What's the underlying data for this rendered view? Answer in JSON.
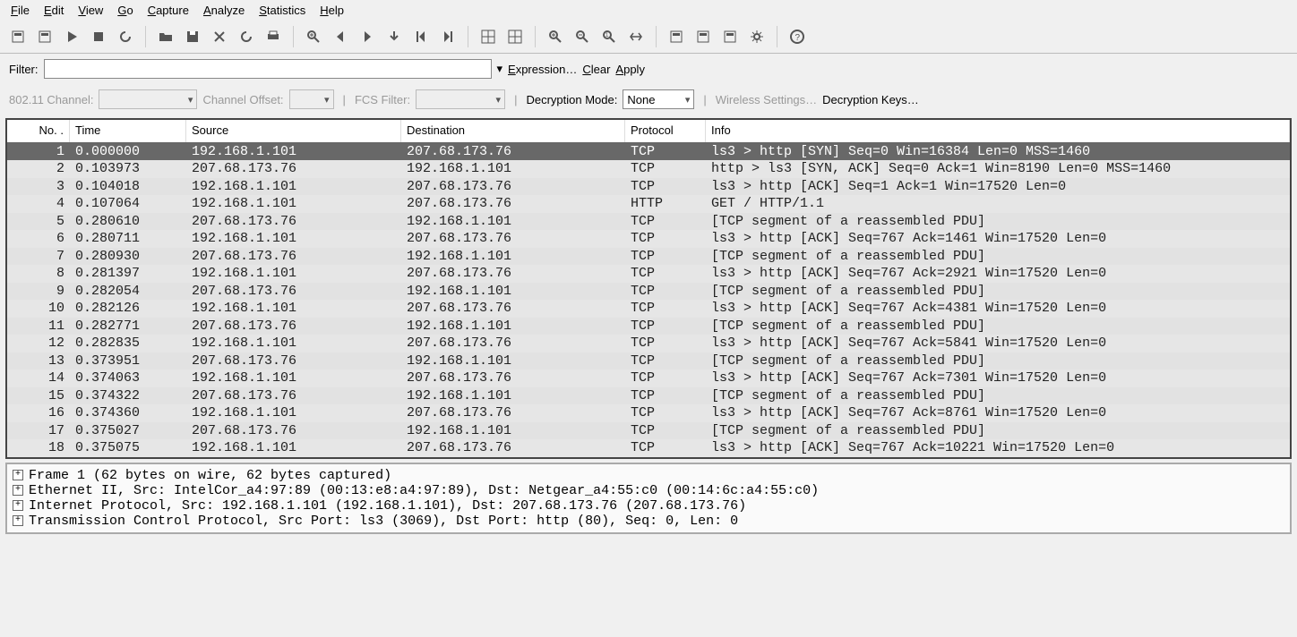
{
  "menu": [
    "File",
    "Edit",
    "View",
    "Go",
    "Capture",
    "Analyze",
    "Statistics",
    "Help"
  ],
  "toolbar_icons": [
    "interfaces-icon",
    "capture-options-icon",
    "capture-start-icon",
    "capture-stop-icon",
    "capture-restart-icon",
    "sep",
    "open-icon",
    "save-icon",
    "close-icon",
    "reload-icon",
    "print-icon",
    "sep",
    "find-icon",
    "back-icon",
    "forward-icon",
    "jump-icon",
    "go-first-icon",
    "go-last-icon",
    "sep",
    "layout1-icon",
    "layout2-icon",
    "sep",
    "zoom-in-icon",
    "zoom-out-icon",
    "zoom-reset-icon",
    "resize-columns-icon",
    "sep",
    "capture-filters-icon",
    "display-filters-icon",
    "coloring-rules-icon",
    "preferences-icon",
    "sep",
    "help-icon"
  ],
  "filter": {
    "label": "Filter:",
    "value": "",
    "dropdown_glyph": "▾",
    "expression": "Expression…",
    "clear": "Clear",
    "apply": "Apply"
  },
  "wireless": {
    "channel_label": "802.11 Channel:",
    "channel_value": "",
    "offset_label": "Channel Offset:",
    "offset_value": "",
    "fcs_label": "FCS Filter:",
    "fcs_value": "",
    "decrypt_label": "Decryption Mode:",
    "decrypt_value": "None",
    "wireless_settings": "Wireless Settings…",
    "decrypt_keys": "Decryption Keys…"
  },
  "columns": [
    "No. .",
    "Time",
    "Source",
    "Destination",
    "Protocol",
    "Info"
  ],
  "packets": [
    {
      "no": 1,
      "time": "0.000000",
      "src": "192.168.1.101",
      "dst": "207.68.173.76",
      "proto": "TCP",
      "info": "ls3 > http [SYN] Seq=0 Win=16384 Len=0 MSS=1460",
      "selected": true
    },
    {
      "no": 2,
      "time": "0.103973",
      "src": "207.68.173.76",
      "dst": "192.168.1.101",
      "proto": "TCP",
      "info": "http > ls3 [SYN, ACK] Seq=0 Ack=1 Win=8190 Len=0 MSS=1460"
    },
    {
      "no": 3,
      "time": "0.104018",
      "src": "192.168.1.101",
      "dst": "207.68.173.76",
      "proto": "TCP",
      "info": "ls3 > http [ACK] Seq=1 Ack=1 Win=17520 Len=0"
    },
    {
      "no": 4,
      "time": "0.107064",
      "src": "192.168.1.101",
      "dst": "207.68.173.76",
      "proto": "HTTP",
      "info": "GET / HTTP/1.1"
    },
    {
      "no": 5,
      "time": "0.280610",
      "src": "207.68.173.76",
      "dst": "192.168.1.101",
      "proto": "TCP",
      "info": "[TCP segment of a reassembled PDU]"
    },
    {
      "no": 6,
      "time": "0.280711",
      "src": "192.168.1.101",
      "dst": "207.68.173.76",
      "proto": "TCP",
      "info": "ls3 > http [ACK] Seq=767 Ack=1461 Win=17520 Len=0"
    },
    {
      "no": 7,
      "time": "0.280930",
      "src": "207.68.173.76",
      "dst": "192.168.1.101",
      "proto": "TCP",
      "info": "[TCP segment of a reassembled PDU]"
    },
    {
      "no": 8,
      "time": "0.281397",
      "src": "192.168.1.101",
      "dst": "207.68.173.76",
      "proto": "TCP",
      "info": "ls3 > http [ACK] Seq=767 Ack=2921 Win=17520 Len=0"
    },
    {
      "no": 9,
      "time": "0.282054",
      "src": "207.68.173.76",
      "dst": "192.168.1.101",
      "proto": "TCP",
      "info": "[TCP segment of a reassembled PDU]"
    },
    {
      "no": 10,
      "time": "0.282126",
      "src": "192.168.1.101",
      "dst": "207.68.173.76",
      "proto": "TCP",
      "info": "ls3 > http [ACK] Seq=767 Ack=4381 Win=17520 Len=0"
    },
    {
      "no": 11,
      "time": "0.282771",
      "src": "207.68.173.76",
      "dst": "192.168.1.101",
      "proto": "TCP",
      "info": "[TCP segment of a reassembled PDU]"
    },
    {
      "no": 12,
      "time": "0.282835",
      "src": "192.168.1.101",
      "dst": "207.68.173.76",
      "proto": "TCP",
      "info": "ls3 > http [ACK] Seq=767 Ack=5841 Win=17520 Len=0"
    },
    {
      "no": 13,
      "time": "0.373951",
      "src": "207.68.173.76",
      "dst": "192.168.1.101",
      "proto": "TCP",
      "info": "[TCP segment of a reassembled PDU]"
    },
    {
      "no": 14,
      "time": "0.374063",
      "src": "192.168.1.101",
      "dst": "207.68.173.76",
      "proto": "TCP",
      "info": "ls3 > http [ACK] Seq=767 Ack=7301 Win=17520 Len=0"
    },
    {
      "no": 15,
      "time": "0.374322",
      "src": "207.68.173.76",
      "dst": "192.168.1.101",
      "proto": "TCP",
      "info": "[TCP segment of a reassembled PDU]"
    },
    {
      "no": 16,
      "time": "0.374360",
      "src": "192.168.1.101",
      "dst": "207.68.173.76",
      "proto": "TCP",
      "info": "ls3 > http [ACK] Seq=767 Ack=8761 Win=17520 Len=0"
    },
    {
      "no": 17,
      "time": "0.375027",
      "src": "207.68.173.76",
      "dst": "192.168.1.101",
      "proto": "TCP",
      "info": "[TCP segment of a reassembled PDU]"
    },
    {
      "no": 18,
      "time": "0.375075",
      "src": "192.168.1.101",
      "dst": "207.68.173.76",
      "proto": "TCP",
      "info": "ls3 > http [ACK] Seq=767 Ack=10221 Win=17520 Len=0"
    }
  ],
  "details": [
    "Frame 1 (62 bytes on wire, 62 bytes captured)",
    "Ethernet II, Src: IntelCor_a4:97:89 (00:13:e8:a4:97:89), Dst: Netgear_a4:55:c0 (00:14:6c:a4:55:c0)",
    "Internet Protocol, Src: 192.168.1.101 (192.168.1.101), Dst: 207.68.173.76 (207.68.173.76)",
    "Transmission Control Protocol, Src Port: ls3 (3069), Dst Port: http (80), Seq: 0, Len: 0"
  ]
}
